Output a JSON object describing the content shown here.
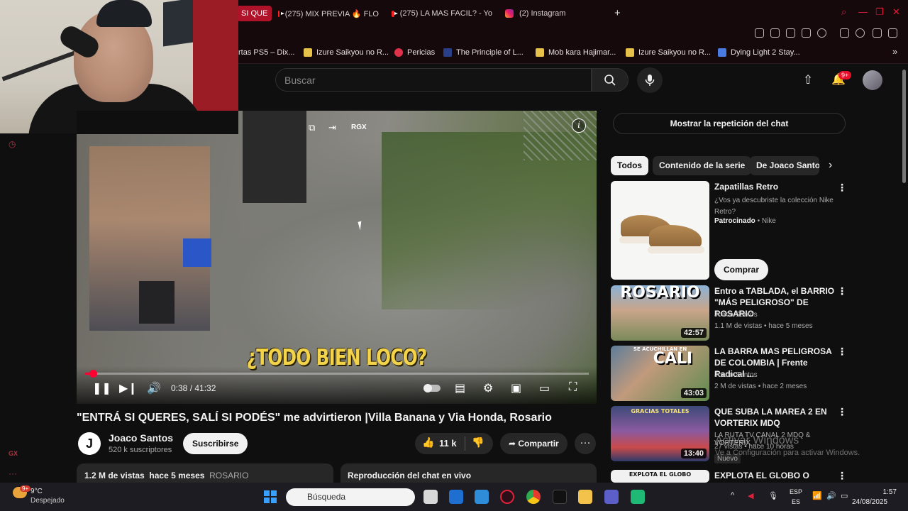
{
  "browser": {
    "tabs": [
      {
        "label": "SI QUE",
        "active": true
      },
      {
        "label": "(275) MIX PREVIA 🔥 FLO",
        "icon": "youtube-icon"
      },
      {
        "label": "(275) LA MAS FACIL? - Yo",
        "icon": "youtube-icon"
      },
      {
        "label": "(2) Instagram",
        "icon": "instagram-icon"
      }
    ],
    "new_tab": "+",
    "bookmarks": [
      "rtas PS5 – Dix...",
      "Izure Saikyou no R...",
      "Pericias",
      "The Principle of L...",
      "Mob kara Hajimar...",
      "Izure Saikyou no R...",
      "Dying Light 2 Stay..."
    ],
    "bookmarks_more": "»"
  },
  "youtube": {
    "search_placeholder": "Buscar",
    "notifications_badge": "9+",
    "player": {
      "subtitle": "¿TODO BIEN LOCO?",
      "overlay_label": "RGX",
      "info_label": "i",
      "time": "0:38 / 41:32",
      "progress_fraction": 0.0153
    },
    "video": {
      "title": "\"ENTRÁ SI QUERES, SALÍ SI PODÉS\" me advirtieron |Villa Banana y Via Honda, Rosario",
      "channel_initial": "J",
      "channel": "Joaco Santos",
      "subscribers": "520 k suscriptores",
      "subscribe_label": "Suscribirse",
      "likes": "11 k",
      "share_label": "Compartir",
      "views": "1.2 M de vistas",
      "age": "hace 5 meses",
      "tag": "ROSARIO",
      "chat_replay_label": "Reproducción del chat en vivo"
    },
    "sidebar": {
      "show_chat_label": "Mostrar la repetición del chat",
      "chips": [
        "Todos",
        "Contenido de la serie",
        "De Joaco Santos"
      ],
      "ad": {
        "title": "Zapatillas Retro",
        "description": "¿Vos ya descubriste la colección Nike Retro?",
        "sponsored": "Patrocinado",
        "advertiser": "Nike",
        "cta": "Comprar"
      },
      "videos": [
        {
          "title": "Entro a TABLADA, el BARRIO \"MÁS PELIGROSO\" DE ROSARIO",
          "channel": "Joaco Santos",
          "meta": "1.1 M de vistas • hace 5 meses",
          "duration": "42:57",
          "thumb_text": "ROSARIO"
        },
        {
          "title": "LA BARRA MAS PELIGROSA DE COLOMBIA | Frente Radical ...",
          "channel": "Joaco Santos",
          "meta": "2 M de vistas • hace 2 meses",
          "duration": "43:03",
          "thumb_text": "CALI",
          "thumb_small": "SE ACUCHILLAN EN"
        },
        {
          "title": "QUE SUBA LA MAREA 2 EN VORTERIX MDQ",
          "channel": "LA RUTA TV CANAL 2 MDQ & VORTERIX ...",
          "meta": "27 vistas • hace 10 horas",
          "duration": "13:40",
          "badge": "Nuevo",
          "thumb_text": "GRACIAS TOTALES"
        },
        {
          "title": "EXPLOTA EL GLOBO O",
          "thumb_text": "EXPLOTA EL GLOBO"
        }
      ]
    }
  },
  "watermark": {
    "line1": "Activar Windows",
    "line2": "Ve a Configuración para activar Windows."
  },
  "taskbar": {
    "weather_temp": "9°C",
    "weather_desc": "Despejado",
    "weather_badge": "9+",
    "search_placeholder": "Búsqueda",
    "lang_top": "ESP",
    "lang_bottom": "ES",
    "time": "1:57",
    "date": "24/08/2025"
  },
  "colors": {
    "accent_red": "#ff0033",
    "browser_bg": "#16090c",
    "page_bg": "#0f0f0f",
    "subtitle_yellow": "#f3d34a"
  }
}
